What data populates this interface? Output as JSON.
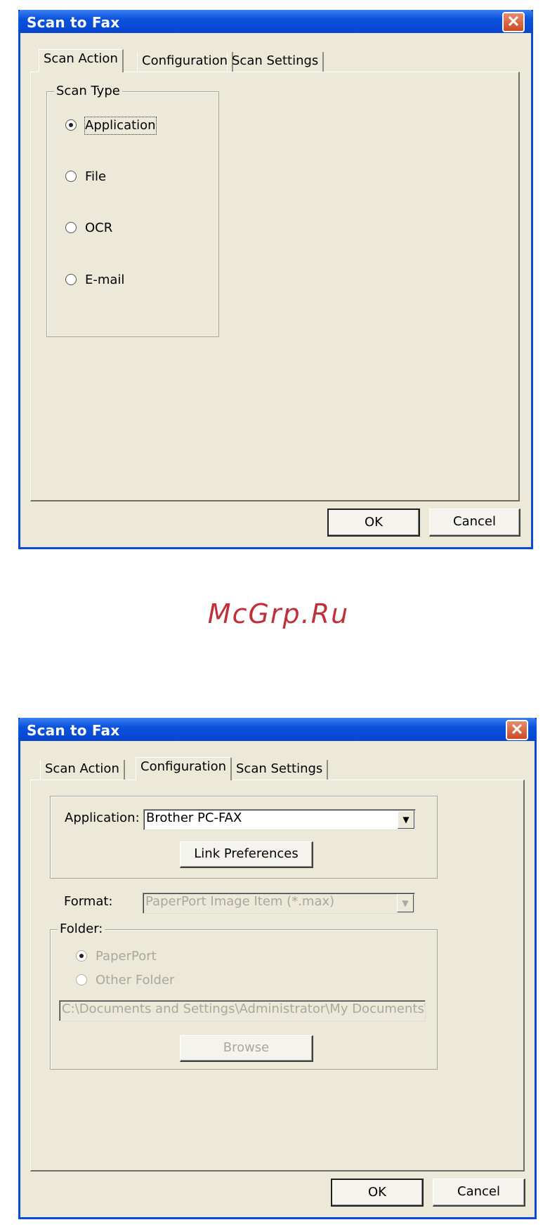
{
  "dialog1": {
    "title": "Scan to Fax",
    "close_symbol": "✕",
    "tabs": [
      "Scan Action",
      "Configuration",
      "Scan Settings"
    ],
    "active_tab": "Scan Action",
    "scan_type": {
      "label": "Scan Type",
      "options": [
        "Application",
        "File",
        "OCR",
        "E-mail"
      ],
      "selected": "Application"
    },
    "ok_label": "OK",
    "cancel_label": "Cancel"
  },
  "watermark": "McGrp.Ru",
  "dialog2": {
    "title": "Scan to Fax",
    "close_symbol": "✕",
    "tabs": [
      "Scan Action",
      "Configuration",
      "Scan Settings"
    ],
    "active_tab": "Configuration",
    "application_label": "Application:",
    "application_value": "Brother PC-FAX",
    "link_preferences_label": "Link Preferences",
    "format_label": "Format:",
    "format_value": "PaperPort Image Item (*.max)",
    "folder": {
      "label": "Folder:",
      "options": [
        "PaperPort",
        "Other Folder"
      ],
      "selected": "PaperPort",
      "path": "C:\\Documents and Settings\\Administrator\\My Documents\\M",
      "browse_label": "Browse"
    },
    "ok_label": "OK",
    "cancel_label": "Cancel",
    "arrow_symbol": "▼"
  }
}
